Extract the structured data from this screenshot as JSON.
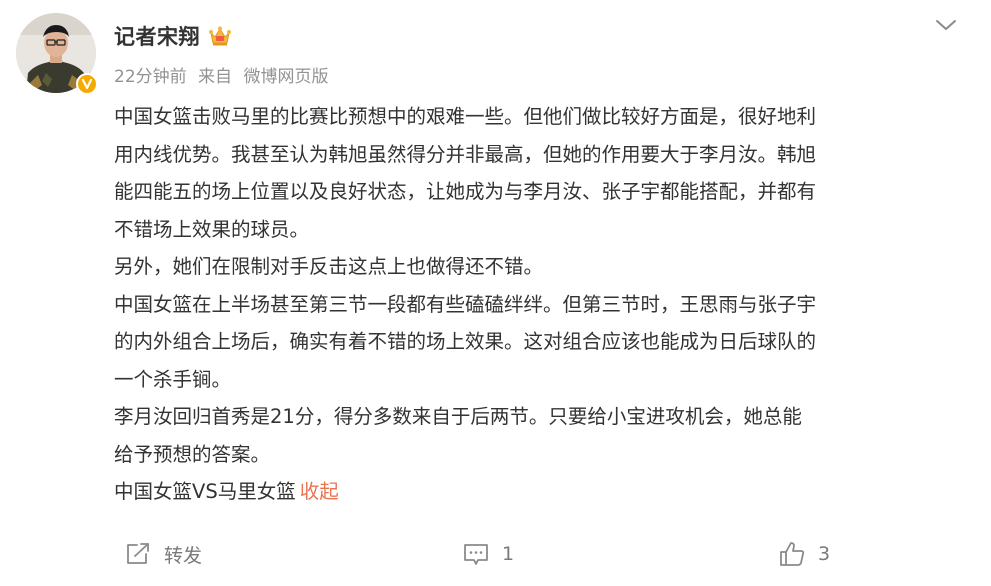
{
  "post": {
    "author": {
      "name": "记者宋翔"
    },
    "meta": {
      "time": "22分钟前",
      "source_prefix": "来自",
      "source": "微博网页版"
    },
    "content": {
      "paragraphs": [
        "中国女篮击败马里的比赛比预想中的艰难一些。但他们做比较好方面是，很好地利",
        "用内线优势。我甚至认为韩旭虽然得分并非最高，但她的作用要大于李月汝。韩旭",
        "能四能五的场上位置以及良好状态，让她成为与李月汝、张子宇都能搭配，并都有",
        "不错场上效果的球员。",
        "另外，她们在限制对手反击这点上也做得还不错。",
        "中国女篮在上半场甚至第三节一段都有些磕磕绊绊。但第三节时，王思雨与张子宇",
        "的内外组合上场后，确实有着不错的场上效果。这对组合应该也能成为日后球队的",
        "一个杀手锏。",
        "李月汝回归首秀是21分，得分多数来自于后两节。只要给小宝进攻机会，她总能",
        "给予预想的答案。"
      ],
      "last_line": "中国女篮VS马里女篮",
      "collapse_label": "收起"
    },
    "actions": {
      "repost_label": "转发",
      "comment_count": "1",
      "like_count": "3"
    },
    "icons": {
      "verified": "verified-badge-icon",
      "vip": "vip-crown-icon",
      "more": "chevron-down-icon",
      "repost": "repost-icon",
      "comment": "comment-icon",
      "like": "thumbs-up-icon"
    },
    "colors": {
      "text": "#333333",
      "meta": "#939393",
      "link": "#eb7350",
      "badge": "#f7a900"
    }
  }
}
